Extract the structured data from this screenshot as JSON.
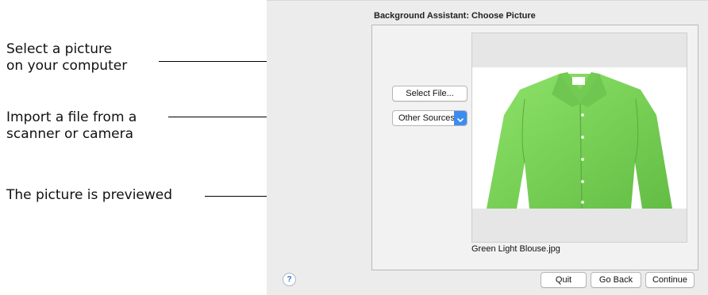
{
  "annotations": {
    "select_picture_line1": "Select a picture",
    "select_picture_line2": "on your computer",
    "import_file_line1": "Import a file from a",
    "import_file_line2": "scanner or camera",
    "preview": "The picture is previewed"
  },
  "dialog": {
    "title": "Background Assistant: Choose Picture",
    "select_file_label": "Select File...",
    "source_popup": {
      "selected": "Other Sources"
    },
    "preview_filename": "Green Light Blouse.jpg",
    "help_label": "?",
    "buttons": {
      "quit": "Quit",
      "go_back": "Go Back",
      "continue": "Continue"
    }
  },
  "colors": {
    "accent": "#3b8cf1",
    "blouse": "#7fd45c"
  },
  "icons": {
    "popup_arrow": "chevron-updown-icon",
    "help": "help-icon"
  }
}
